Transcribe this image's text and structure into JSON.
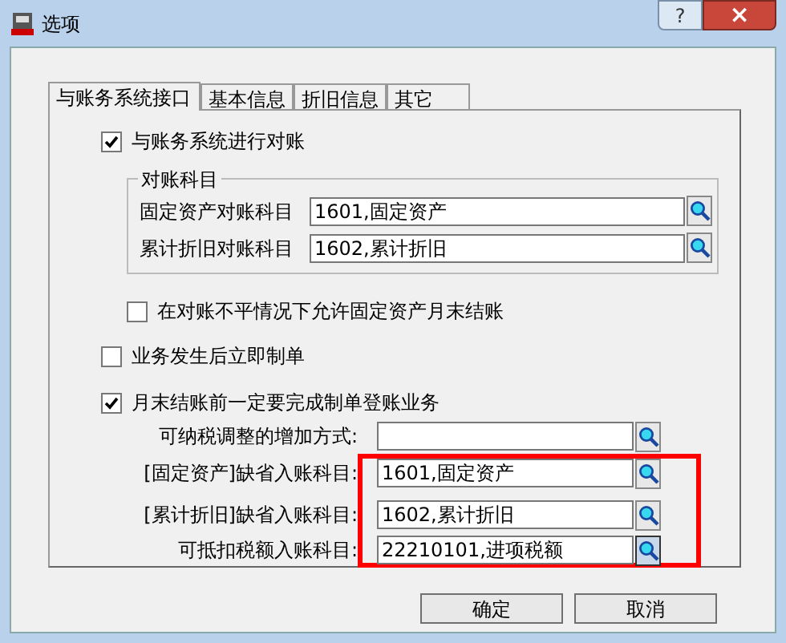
{
  "window": {
    "title": "选项",
    "help": "?",
    "close": "×"
  },
  "tabs": [
    {
      "label": "与账务系统接口",
      "selected": true
    },
    {
      "label": "基本信息",
      "selected": false
    },
    {
      "label": "折旧信息",
      "selected": false
    },
    {
      "label": "其它",
      "selected": false
    }
  ],
  "sync": {
    "label": "与账务系统进行对账",
    "checked": true,
    "group": {
      "title": "对账科目",
      "fields": [
        {
          "label": "固定资产对账科目",
          "value": "1601,固定资产"
        },
        {
          "label": "累计折旧对账科目",
          "value": "1602,累计折旧"
        }
      ]
    },
    "sub_options": [
      {
        "label": "在对账不平情况下允许固定资产月末结账",
        "checked": false
      }
    ]
  },
  "options": [
    {
      "label": "业务发生后立即制单",
      "checked": false
    },
    {
      "label": "月末结账前一定要完成制单登账业务",
      "checked": true
    }
  ],
  "accounts": [
    {
      "label": "可纳税调整的增加方式:",
      "pressed": false
    },
    {
      "label": "[固定资产]缺省入账科目:",
      "value": "1601,固定资产",
      "pressed": false
    },
    {
      "label": "[累计折旧]缺省入账科目:",
      "value": "1602,累计折旧",
      "pressed": false
    },
    {
      "label": "可抵扣税额入账科目:",
      "value": "22210101,进项税额",
      "pressed": true
    }
  ],
  "buttons": [
    "确定",
    "取消"
  ]
}
